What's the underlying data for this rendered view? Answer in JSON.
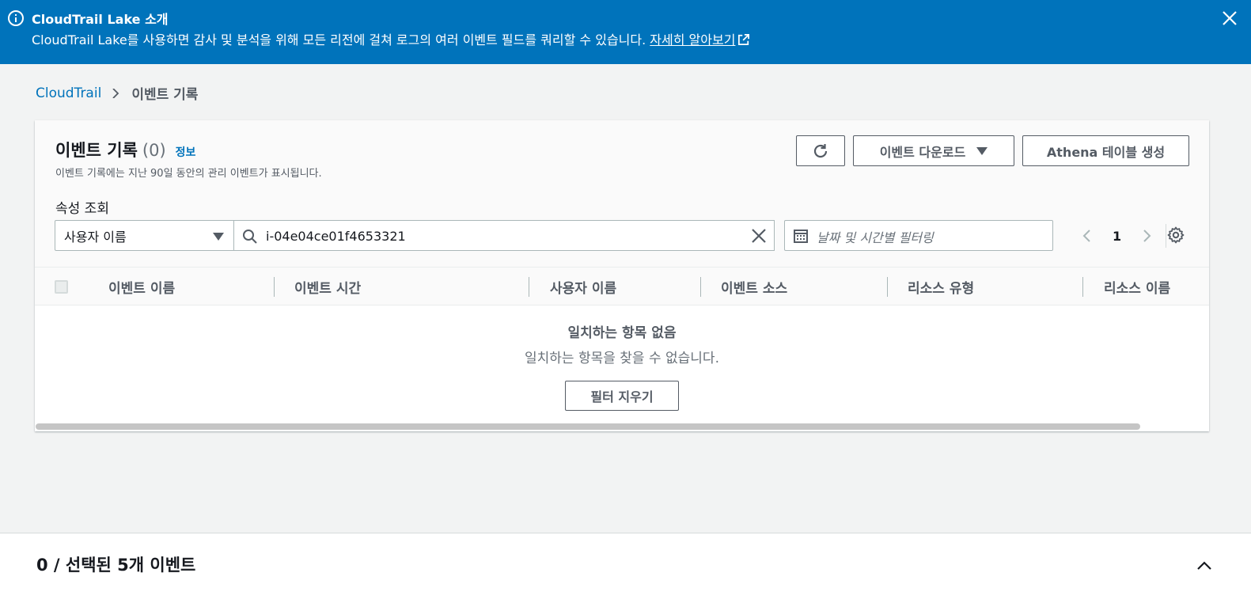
{
  "banner": {
    "title": "CloudTrail Lake 소개",
    "body": "CloudTrail Lake를 사용하면 감사 및 분석을 위해 모든 리전에 걸쳐 로그의 여러 이벤트 필드를 쿼리할 수 있습니다. ",
    "link": "자세히 알아보기",
    "color": "#0073bb"
  },
  "breadcrumb": {
    "root": "CloudTrail",
    "current": "이벤트 기록"
  },
  "panel": {
    "title": "이벤트 기록",
    "count": "(0)",
    "info": "정보",
    "description": "이벤트 기록에는 지난 90일 동안의 관리 이벤트가 표시됩니다.",
    "download_label": "이벤트 다운로드",
    "athena_label": "Athena 테이블 생성",
    "attr_label": "속성 조회",
    "attr_selected": "사용자 이름",
    "search_value": "i-04e04ce01f4653321",
    "date_placeholder": "날짜 및 시간별 필터링",
    "page": "1"
  },
  "table": {
    "columns": [
      "이벤트 이름",
      "이벤트 시간",
      "사용자 이름",
      "이벤트 소스",
      "리소스 유형",
      "리소스 이름"
    ],
    "empty_title": "일치하는 항목 없음",
    "empty_desc": "일치하는 항목을 찾을 수 없습니다.",
    "clear_filter": "필터 지우기"
  },
  "bottom": {
    "selection_text": "0 / 선택된 5개 이벤트"
  }
}
